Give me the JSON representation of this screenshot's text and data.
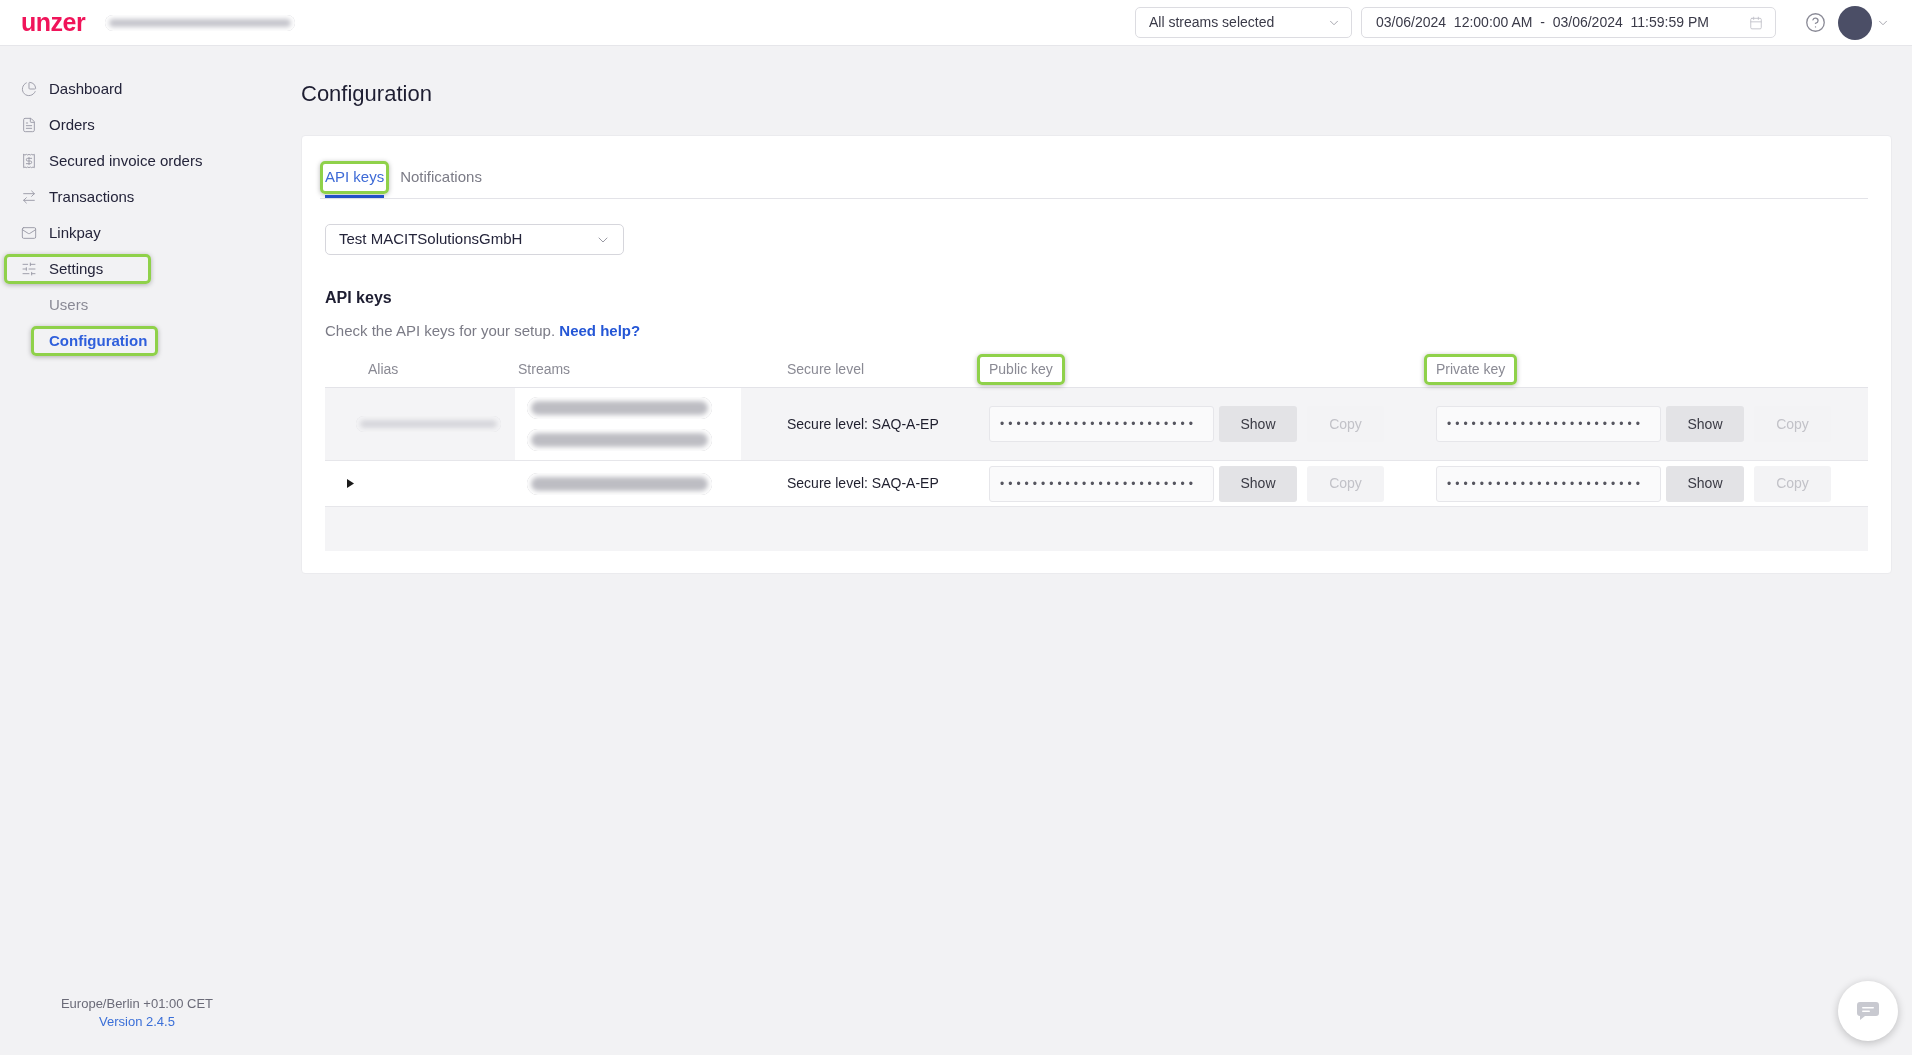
{
  "header": {
    "logo": "unzer",
    "account_name_blurred": true,
    "stream_select": {
      "value": "All streams selected"
    },
    "date_range": {
      "value": "03/06/2024  12:00:00 AM  -  03/06/2024  11:59:59 PM"
    }
  },
  "sidebar": {
    "items": [
      {
        "label": "Dashboard",
        "selected": false,
        "highlighted": false
      },
      {
        "label": "Orders",
        "selected": false,
        "highlighted": false
      },
      {
        "label": "Secured invoice orders",
        "selected": false,
        "highlighted": false
      },
      {
        "label": "Transactions",
        "selected": false,
        "highlighted": false
      },
      {
        "label": "Linkpay",
        "selected": false,
        "highlighted": false
      },
      {
        "label": "Settings",
        "selected": false,
        "highlighted": true,
        "children": [
          {
            "label": "Users",
            "selected": false,
            "highlighted": false
          },
          {
            "label": "Configuration",
            "selected": true,
            "highlighted": true
          }
        ]
      }
    ],
    "timezone": "Europe/Berlin +01:00 CET",
    "version": "Version 2.4.5"
  },
  "page": {
    "title": "Configuration"
  },
  "tabs": [
    {
      "label": "API keys",
      "selected": true,
      "highlighted": true
    },
    {
      "label": "Notifications",
      "selected": false,
      "highlighted": false
    }
  ],
  "merchant_select": {
    "value": "Test MACITSolutionsGmbH"
  },
  "api_keys": {
    "title": "API keys",
    "description": "Check the API keys for your setup.",
    "help_link": "Need help?"
  },
  "table": {
    "columns": [
      {
        "label": "Alias",
        "highlighted": false
      },
      {
        "label": "Streams",
        "highlighted": false
      },
      {
        "label": "Secure level",
        "highlighted": false
      },
      {
        "label": "Public key",
        "highlighted": true
      },
      {
        "label": "Private key",
        "highlighted": true
      }
    ],
    "rows": [
      {
        "selected": true,
        "expandable": false,
        "alias_blurred": true,
        "streams": [
          {
            "blurred": true
          },
          {
            "blurred": true
          }
        ],
        "secure_level": "Secure level: SAQ-A-EP",
        "public_key": {
          "value": "••••••••••••••••••••••••",
          "show": {
            "label": "Show",
            "disabled": false
          },
          "copy": {
            "label": "Copy",
            "disabled": true
          }
        },
        "private_key": {
          "value": "••••••••••••••••••••••••",
          "show": {
            "label": "Show",
            "disabled": false
          },
          "copy": {
            "label": "Copy",
            "disabled": true
          }
        }
      },
      {
        "selected": false,
        "expandable": true,
        "alias_blurred": false,
        "streams": [
          {
            "blurred": true
          }
        ],
        "secure_level": "Secure level: SAQ-A-EP",
        "public_key": {
          "value": "••••••••••••••••••••••••",
          "show": {
            "label": "Show",
            "disabled": false
          },
          "copy": {
            "label": "Copy",
            "disabled": true
          }
        },
        "private_key": {
          "value": "••••••••••••••••••••••••",
          "show": {
            "label": "Show",
            "disabled": false
          },
          "copy": {
            "label": "Copy",
            "disabled": true
          }
        }
      }
    ]
  }
}
